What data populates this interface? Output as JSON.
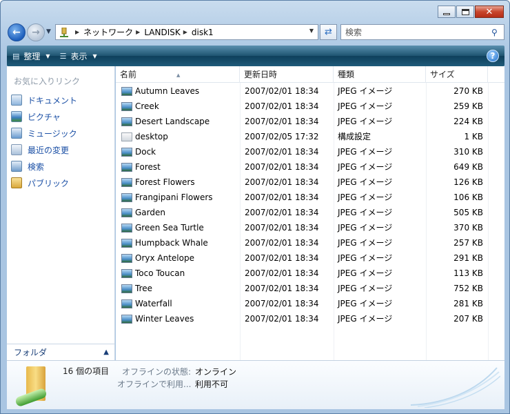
{
  "window": {
    "caption_buttons": {
      "minimize": "minimize",
      "maximize": "maximize",
      "close": "✕"
    }
  },
  "address_bar": {
    "crumbs": [
      "ネットワーク",
      "LANDISK",
      "disk1"
    ]
  },
  "search": {
    "placeholder": "検索"
  },
  "command_bar": {
    "organize_label": "整理",
    "views_label": "表示",
    "help": "?"
  },
  "nav_pane": {
    "title": "お気に入りリンク",
    "items": [
      {
        "label": "ドキュメント",
        "icon": "documents-icon"
      },
      {
        "label": "ピクチャ",
        "icon": "pictures-icon"
      },
      {
        "label": "ミュージック",
        "icon": "music-icon"
      },
      {
        "label": "最近の変更",
        "icon": "recent-icon"
      },
      {
        "label": "検索",
        "icon": "search-folder-icon"
      },
      {
        "label": "パブリック",
        "icon": "public-folder-icon"
      }
    ],
    "folders_label": "フォルダ"
  },
  "columns": {
    "name": "名前",
    "date": "更新日時",
    "type": "種類",
    "size": "サイズ"
  },
  "files": [
    {
      "name": "Autumn Leaves",
      "date": "2007/02/01 18:34",
      "type": "JPEG イメージ",
      "size": "270 KB",
      "icon": "image-file-icon"
    },
    {
      "name": "Creek",
      "date": "2007/02/01 18:34",
      "type": "JPEG イメージ",
      "size": "259 KB",
      "icon": "image-file-icon"
    },
    {
      "name": "Desert Landscape",
      "date": "2007/02/01 18:34",
      "type": "JPEG イメージ",
      "size": "224 KB",
      "icon": "image-file-icon"
    },
    {
      "name": "desktop",
      "date": "2007/02/05 17:32",
      "type": "構成設定",
      "size": "1 KB",
      "icon": "settings-file-icon"
    },
    {
      "name": "Dock",
      "date": "2007/02/01 18:34",
      "type": "JPEG イメージ",
      "size": "310 KB",
      "icon": "image-file-icon"
    },
    {
      "name": "Forest",
      "date": "2007/02/01 18:34",
      "type": "JPEG イメージ",
      "size": "649 KB",
      "icon": "image-file-icon"
    },
    {
      "name": "Forest Flowers",
      "date": "2007/02/01 18:34",
      "type": "JPEG イメージ",
      "size": "126 KB",
      "icon": "image-file-icon"
    },
    {
      "name": "Frangipani Flowers",
      "date": "2007/02/01 18:34",
      "type": "JPEG イメージ",
      "size": "106 KB",
      "icon": "image-file-icon"
    },
    {
      "name": "Garden",
      "date": "2007/02/01 18:34",
      "type": "JPEG イメージ",
      "size": "505 KB",
      "icon": "image-file-icon"
    },
    {
      "name": "Green Sea Turtle",
      "date": "2007/02/01 18:34",
      "type": "JPEG イメージ",
      "size": "370 KB",
      "icon": "image-file-icon"
    },
    {
      "name": "Humpback Whale",
      "date": "2007/02/01 18:34",
      "type": "JPEG イメージ",
      "size": "257 KB",
      "icon": "image-file-icon"
    },
    {
      "name": "Oryx Antelope",
      "date": "2007/02/01 18:34",
      "type": "JPEG イメージ",
      "size": "291 KB",
      "icon": "image-file-icon"
    },
    {
      "name": "Toco Toucan",
      "date": "2007/02/01 18:34",
      "type": "JPEG イメージ",
      "size": "113 KB",
      "icon": "image-file-icon"
    },
    {
      "name": "Tree",
      "date": "2007/02/01 18:34",
      "type": "JPEG イメージ",
      "size": "752 KB",
      "icon": "image-file-icon"
    },
    {
      "name": "Waterfall",
      "date": "2007/02/01 18:34",
      "type": "JPEG イメージ",
      "size": "281 KB",
      "icon": "image-file-icon"
    },
    {
      "name": "Winter Leaves",
      "date": "2007/02/01 18:34",
      "type": "JPEG イメージ",
      "size": "207 KB",
      "icon": "image-file-icon"
    }
  ],
  "details": {
    "item_count": "16 個の項目",
    "offline_status_label": "オフラインの状態:",
    "offline_status_value": "オンライン",
    "offline_use_label": "オフラインで利用...",
    "offline_use_value": "利用不可"
  },
  "colors": {
    "link": "#1a4fa5",
    "command_bar": "#1e5471",
    "window_frame": "#b8d0e8"
  }
}
